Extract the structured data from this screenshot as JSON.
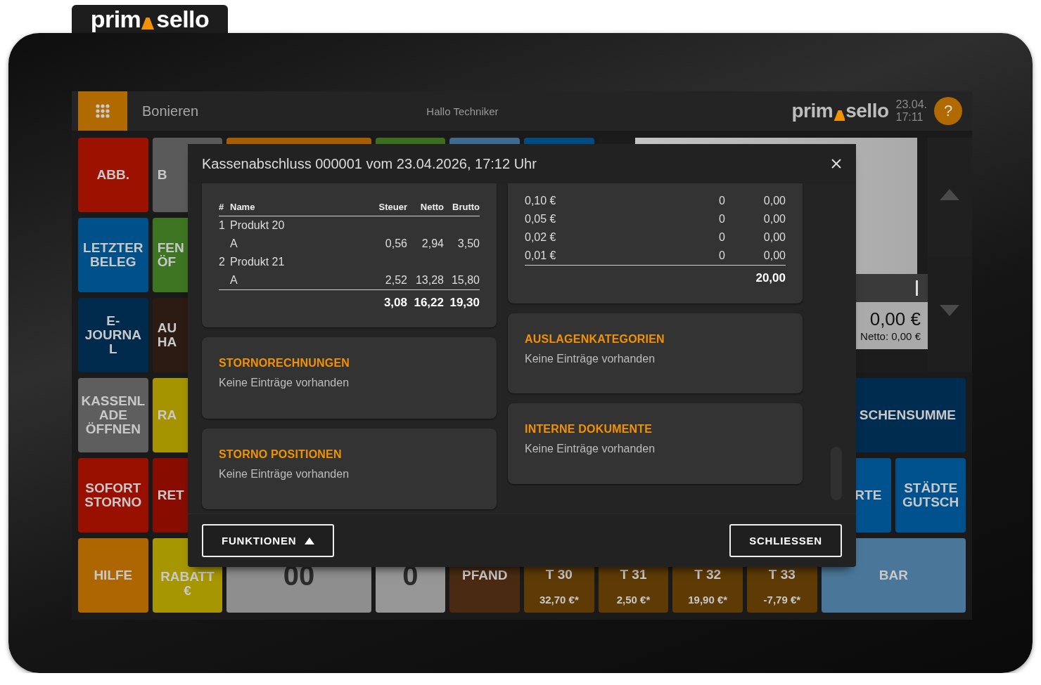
{
  "brand_tab": {
    "left": "prim",
    "right": "sello"
  },
  "top_bar": {
    "title": "Bonieren",
    "greeting": "Hallo Techniker",
    "logo": {
      "left": "prim",
      "right": "sello"
    },
    "date": "23.04.",
    "time": "17:11",
    "help": "?"
  },
  "tiles": [
    {
      "kind": "function",
      "label": [
        "ABB."
      ],
      "color": "#9c1100"
    },
    {
      "kind": "function",
      "label": [
        "B"
      ],
      "color": "#5a5a5a"
    },
    {
      "kind": "function",
      "color": "#a55d00"
    },
    {
      "kind": "function",
      "color": "#3d6e1f"
    },
    {
      "kind": "function",
      "color": "#3f6b8f"
    },
    {
      "kind": "function",
      "color": "#004b82"
    },
    {
      "kind": "function",
      "label": [
        "LETZTER",
        "BELEG"
      ],
      "color": "#00508a"
    },
    {
      "kind": "function",
      "label": [
        "FEN",
        "ÖF"
      ],
      "color": "#3e7523"
    },
    {
      "kind": "function",
      "label": [
        "E-",
        "JOURNA",
        "L"
      ],
      "color": "#002a4c"
    },
    {
      "kind": "function",
      "label": [
        "AU",
        "HA"
      ],
      "color": "#2c1b12"
    },
    {
      "kind": "function",
      "label": [
        "KASSENL",
        "ADE",
        "ÖFFNEN"
      ],
      "color": "#5e5e5e"
    },
    {
      "kind": "function",
      "label": [
        "RA"
      ],
      "color": "#a69300"
    },
    {
      "kind": "function",
      "label": [
        "SCHENSUMME"
      ],
      "color": "#002c50"
    },
    {
      "kind": "function",
      "label": [
        "SOFORT",
        "STORNO"
      ],
      "color": "#9a1000"
    },
    {
      "kind": "function",
      "label": [
        "RET"
      ],
      "color": "#880d00"
    },
    {
      "kind": "function",
      "label": [
        "RTE"
      ],
      "color": "#00528f"
    },
    {
      "kind": "function",
      "label": [
        "STÄDTE",
        "GUTSCH"
      ],
      "color": "#00528f"
    },
    {
      "kind": "function",
      "label": [
        "HILFE"
      ],
      "color": "#ad6600"
    },
    {
      "kind": "function",
      "label": [
        "RABATT",
        "€"
      ],
      "color": "#a69600"
    },
    {
      "kind": "digit",
      "label": [
        "00"
      ],
      "color": "#8e8e8e"
    },
    {
      "kind": "digit",
      "label": [
        "0"
      ],
      "color": "#969696"
    },
    {
      "kind": "function",
      "label": [
        "PFAND"
      ],
      "color": "#4a2a12"
    },
    {
      "kind": "table",
      "label": [
        "T 30"
      ],
      "price": "32,70 €*",
      "color": "#5e3a05"
    },
    {
      "kind": "table",
      "label": [
        "T 31"
      ],
      "price": "2,50 €*",
      "color": "#5e3a05"
    },
    {
      "kind": "table",
      "label": [
        "T 32"
      ],
      "price": "19,90 €*",
      "color": "#5e3a05"
    },
    {
      "kind": "table",
      "label": [
        "T 33"
      ],
      "price": "-7,79 €*",
      "color": "#5e3a05"
    },
    {
      "kind": "function",
      "label": [
        "BAR"
      ],
      "color": "#4a7699"
    }
  ],
  "receipt": {
    "total": "0,00 €",
    "net": "Netto: 0,00 €"
  },
  "dialog": {
    "title": "Kassenabschluss 000001 vom 23.04.2026, 17:12 Uhr",
    "columns": [
      [
        {
          "kind": "positions",
          "headers": [
            "#",
            "Name",
            "Steuer",
            "Netto",
            "Brutto"
          ],
          "items": [
            {
              "number": "1",
              "name": "Produkt 20",
              "lines": [
                {
                  "label": "A",
                  "tax": "0,56",
                  "net": "2,94",
                  "gross": "3,50"
                }
              ]
            },
            {
              "number": "2",
              "name": "Produkt 21",
              "lines": [
                {
                  "label": "A",
                  "tax": "2,52",
                  "net": "13,28",
                  "gross": "15,80"
                }
              ]
            }
          ],
          "totals": [
            "3,08",
            "16,22",
            "19,30"
          ]
        },
        {
          "kind": "section",
          "title": "STORNORECHNUNGEN",
          "text": "Keine Einträge vorhanden"
        },
        {
          "kind": "section",
          "title": "STORNO POSITIONEN",
          "text": "Keine Einträge vorhanden"
        }
      ],
      [
        {
          "kind": "cash_count",
          "rows": [
            {
              "denomination": "0,10 €",
              "count": "0",
              "amount": "0,00"
            },
            {
              "denomination": "0,05 €",
              "count": "0",
              "amount": "0,00"
            },
            {
              "denomination": "0,02 €",
              "count": "0",
              "amount": "0,00"
            },
            {
              "denomination": "0,01 €",
              "count": "0",
              "amount": "0,00"
            }
          ],
          "total": "20,00"
        },
        {
          "kind": "section",
          "title": "AUSLAGENKATEGORIEN",
          "text": "Keine Einträge vorhanden"
        },
        {
          "kind": "section",
          "title": "INTERNE DOKUMENTE",
          "text": "Keine Einträge vorhanden"
        }
      ]
    ],
    "buttons": [
      {
        "kind": "menu",
        "label": "FUNKTIONEN"
      },
      {
        "kind": "plain",
        "label": "SCHLIESSEN"
      }
    ]
  }
}
